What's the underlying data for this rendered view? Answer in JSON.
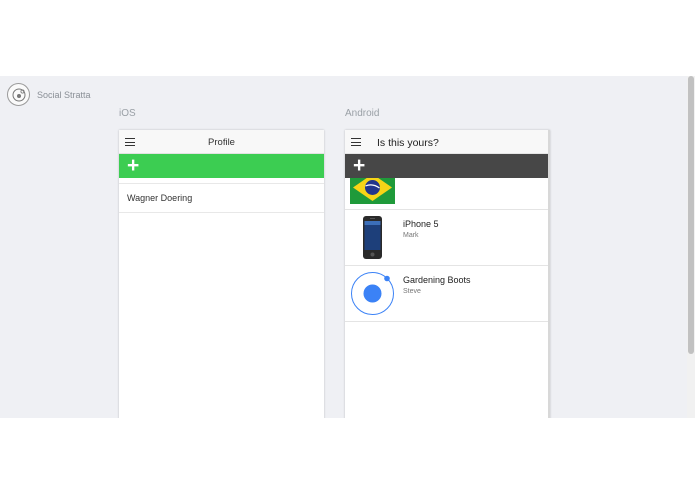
{
  "brand": {
    "name": "Social Stratta"
  },
  "platforms": {
    "ios": "iOS",
    "android": "Android"
  },
  "ios": {
    "title": "Profile",
    "add_label": "+",
    "items": [
      {
        "name": "Wagner Doering"
      }
    ]
  },
  "android": {
    "title": "Is this yours?",
    "add_label": "+",
    "items": [
      {
        "title": "",
        "subtitle": "",
        "thumb": "brazil-flag"
      },
      {
        "title": "iPhone 5",
        "subtitle": "Mark",
        "thumb": "iphone"
      },
      {
        "title": "Gardening Boots",
        "subtitle": "Steve",
        "thumb": "spinner-circle"
      }
    ]
  },
  "colors": {
    "ios_accent": "#3ccd52",
    "android_bar": "#474747",
    "spinner_blue": "#3b82f6",
    "stage_bg": "#eff0f4"
  }
}
